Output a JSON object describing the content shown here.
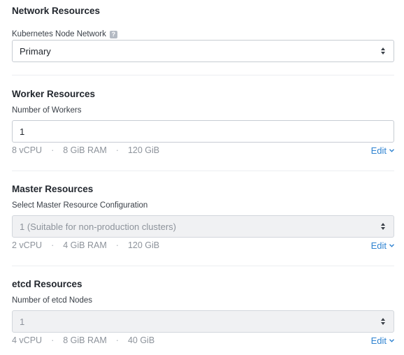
{
  "network": {
    "title": "Network Resources",
    "field_label": "Kubernetes Node Network",
    "help_glyph": "?",
    "selected": "Primary"
  },
  "worker": {
    "title": "Worker Resources",
    "field_label": "Number of Workers",
    "value": "1",
    "specs": [
      "8 vCPU",
      "8 GiB RAM",
      "120 GiB"
    ],
    "edit_label": "Edit"
  },
  "master": {
    "title": "Master Resources",
    "field_label": "Select Master Resource Configuration",
    "selected": "1 (Suitable for non-production clusters)",
    "specs": [
      "2 vCPU",
      "4 GiB RAM",
      "120 GiB"
    ],
    "edit_label": "Edit"
  },
  "etcd": {
    "title": "etcd Resources",
    "field_label": "Number of etcd Nodes",
    "selected": "1",
    "specs": [
      "4 vCPU",
      "8 GiB RAM",
      "40 GiB"
    ],
    "edit_label": "Edit"
  },
  "spec_separator": "·",
  "colors": {
    "link": "#2f83d1",
    "muted_text": "#8d939b",
    "border": "#c7ccd3"
  }
}
